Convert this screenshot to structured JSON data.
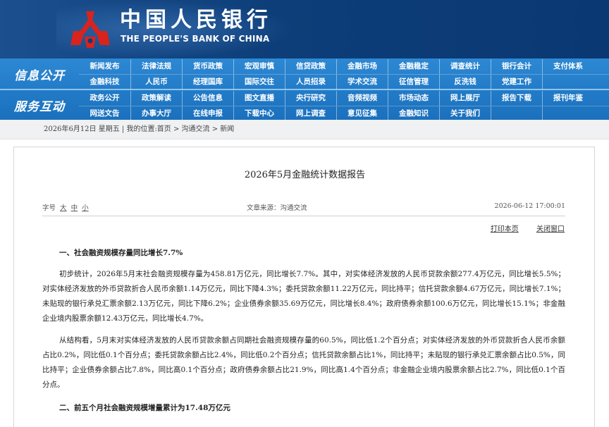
{
  "header": {
    "title_cn": "中国人民银行",
    "title_en": "THE PEOPLE'S BANK OF CHINA",
    "logo_icon": "pboc-logo-icon",
    "brand_color": "#0d3e79",
    "logo_color": "#d9231d"
  },
  "nav": {
    "group1_label": "信息公开",
    "group2_label": "服务互动",
    "row1": [
      "新闻发布",
      "法律法规",
      "货币政策",
      "宏观审慎",
      "信贷政策",
      "金融市场",
      "金融稳定",
      "调查统计",
      "银行会计",
      "支付体系"
    ],
    "row2": [
      "金融科技",
      "人民币",
      "经理国库",
      "国际交往",
      "人员招录",
      "学术交流",
      "征信管理",
      "反洗钱",
      "党建工作",
      ""
    ],
    "row3": [
      "政务公开",
      "政策解读",
      "公告信息",
      "图文直播",
      "央行研究",
      "音频视频",
      "市场动态",
      "网上展厅",
      "报告下载",
      "报刊年鉴"
    ],
    "row4": [
      "网送文告",
      "办事大厅",
      "在线申报",
      "下载中心",
      "网上调查",
      "意见征集",
      "金融知识",
      "关于我们",
      "",
      ""
    ],
    "accent_color": "#1a70bd"
  },
  "breadcrumb": {
    "text": "2026年6月12日 星期五 | 我的位置:首页 > 沟通交流 > 新闻"
  },
  "article": {
    "title": "2026年5月金融统计数据报告",
    "font_size_label": "字号",
    "font_sizes": [
      "大",
      "中",
      "小"
    ],
    "source": "文章来源：沟通交流",
    "datetime": "2026-06-12 17:00:01",
    "print_label": "打印本页",
    "close_label": "关闭窗口",
    "heading1": "一、社会融资规模存量同比增长7.7%",
    "para1": "初步统计，2026年5月末社会融资规模存量为458.81万亿元，同比增长7.7%。其中，对实体经济发放的人民币贷款余额277.4万亿元，同比增长5.5%；对实体经济发放的外币贷款折合人民币余额1.14万亿元，同比下降4.3%；委托贷款余额11.22万亿元，同比持平；信托贷款余额4.67万亿元，同比增长7.1%；未贴现的银行承兑汇票余额2.13万亿元，同比下降6.2%；企业债券余额35.69万亿元，同比增长8.4%；政府债券余额100.6万亿元，同比增长15.1%；非金融企业境内股票余额12.43万亿元，同比增长4.7%。",
    "para2": "从结构看，5月末对实体经济发放的人民币贷款余额占同期社会融资规模存量的60.5%，同比低1.2个百分点；对实体经济发放的外币贷款折合人民币余额占比0.2%，同比低0.1个百分点；委托贷款余额占比2.4%，同比低0.2个百分点；信托贷款余额占比1%，同比持平；未贴现的银行承兑汇票余额占比0.5%，同比持平；企业债券余额占比7.8%，同比高0.1个百分点；政府债券余额占比21.9%，同比高1.4个百分点；非金融企业境内股票余额占比2.7%，同比低0.1个百分点。",
    "heading2": "二、前五个月社会融资规模增量累计为17.48万亿元"
  }
}
